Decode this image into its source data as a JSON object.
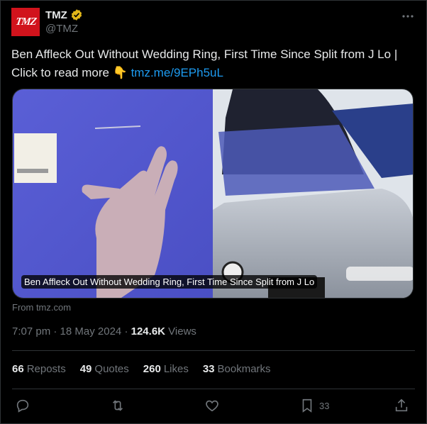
{
  "author": {
    "avatar_text": "TMZ",
    "display_name": "TMZ",
    "handle": "@TMZ",
    "verified_color": "#e2b719",
    "brand_color": "#d1131c"
  },
  "tweet": {
    "text": "Ben Affleck Out Without Wedding Ring, First Time Since Split from J Lo  |  Click to read more 👇 ",
    "link": "tmz.me/9EPh5uL",
    "link_color": "#1d9bf0"
  },
  "media": {
    "caption": "Ben Affleck Out Without Wedding Ring, First Time Since Split from J Lo",
    "source": "From tmz.com"
  },
  "meta": {
    "time": "7:07 pm",
    "date": "18 May 2024",
    "views_count": "124.6K",
    "views_label": "Views"
  },
  "stats": {
    "reposts_count": "66",
    "reposts_label": "Reposts",
    "quotes_count": "49",
    "quotes_label": "Quotes",
    "likes_count": "260",
    "likes_label": "Likes",
    "bookmarks_count": "33",
    "bookmarks_label": "Bookmarks"
  },
  "actions": {
    "reply_icon": "reply-icon",
    "repost_icon": "repost-icon",
    "like_icon": "heart-icon",
    "bookmark_icon": "bookmark-icon",
    "bookmark_count": "33",
    "share_icon": "share-icon"
  }
}
